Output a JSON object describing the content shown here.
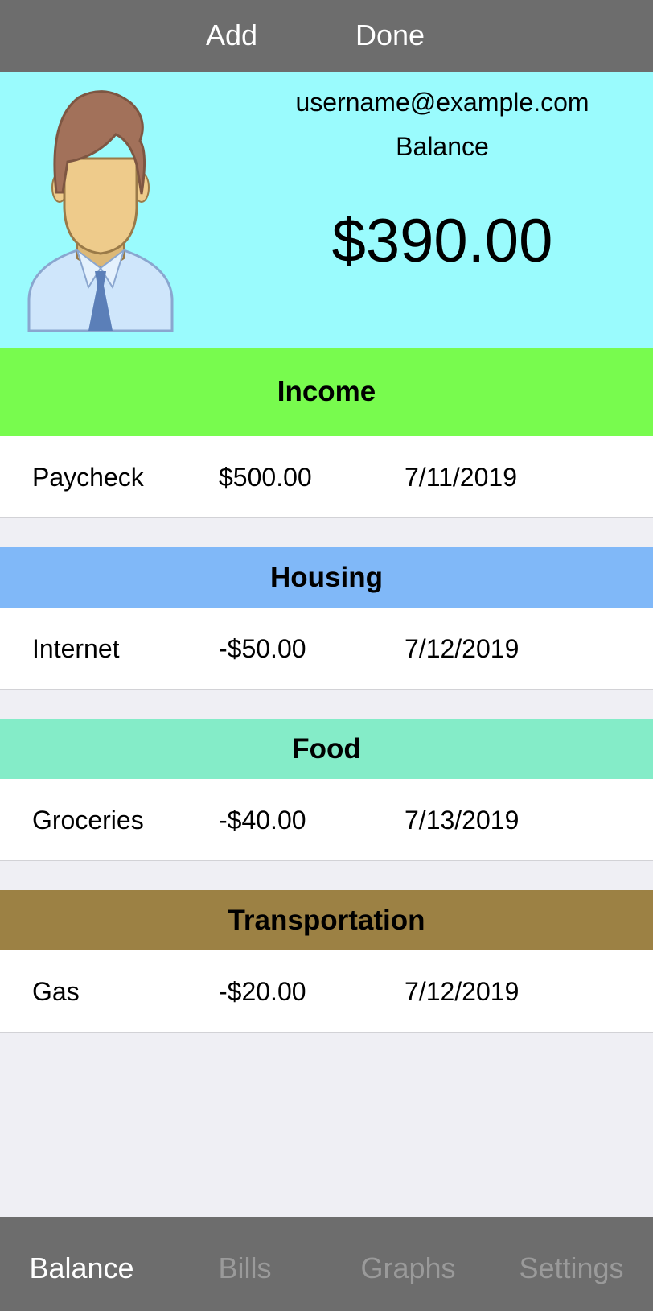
{
  "toolbar": {
    "add_label": "Add",
    "done_label": "Done"
  },
  "profile": {
    "email": "username@example.com",
    "balance_label": "Balance",
    "balance_value": "$390.00"
  },
  "sections": [
    {
      "title": "Income",
      "color": "#78fb4e",
      "rows": [
        {
          "name": "Paycheck",
          "amount": "$500.00",
          "date": "7/11/2019"
        }
      ]
    },
    {
      "title": "Housing",
      "color": "#80b8f8",
      "rows": [
        {
          "name": "Internet",
          "amount": "-$50.00",
          "date": "7/12/2019"
        }
      ]
    },
    {
      "title": "Food",
      "color": "#84ecc8",
      "rows": [
        {
          "name": "Groceries",
          "amount": "-$40.00",
          "date": "7/13/2019"
        }
      ]
    },
    {
      "title": "Transportation",
      "color": "#9c8144",
      "rows": [
        {
          "name": "Gas",
          "amount": "-$20.00",
          "date": "7/12/2019"
        }
      ]
    }
  ],
  "tabs": [
    {
      "label": "Balance",
      "active": true
    },
    {
      "label": "Bills",
      "active": false
    },
    {
      "label": "Graphs",
      "active": false
    },
    {
      "label": "Settings",
      "active": false
    }
  ],
  "colors": {
    "bar_background": "#6d6d6d",
    "header_background": "#9afbfd",
    "tab_active": "#ffffff",
    "tab_inactive": "#9a9a9a"
  }
}
